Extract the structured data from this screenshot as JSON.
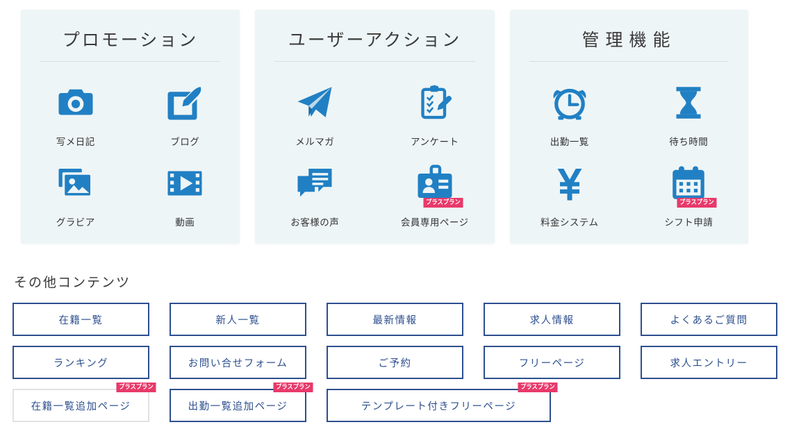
{
  "cards": [
    {
      "title": "プロモーション",
      "items": [
        {
          "label": "写メ日記",
          "icon": "camera-icon",
          "badge": null
        },
        {
          "label": "ブログ",
          "icon": "pencil-square-icon",
          "badge": null
        },
        {
          "label": "グラビア",
          "icon": "photos-icon",
          "badge": null
        },
        {
          "label": "動画",
          "icon": "film-play-icon",
          "badge": null
        }
      ]
    },
    {
      "title": "ユーザーアクション",
      "items": [
        {
          "label": "メルマガ",
          "icon": "paper-plane-icon",
          "badge": null
        },
        {
          "label": "アンケート",
          "icon": "clipboard-pencil-icon",
          "badge": null
        },
        {
          "label": "お客様の声",
          "icon": "chat-bubbles-icon",
          "badge": null
        },
        {
          "label": "会員専用ページ",
          "icon": "id-card-icon",
          "badge": "プラスプラン"
        }
      ]
    },
    {
      "title": "管理機能",
      "items": [
        {
          "label": "出勤一覧",
          "icon": "alarm-clock-icon",
          "badge": null
        },
        {
          "label": "待ち時間",
          "icon": "hourglass-icon",
          "badge": null
        },
        {
          "label": "料金システム",
          "icon": "yen-icon",
          "badge": null
        },
        {
          "label": "シフト申請",
          "icon": "calendar-icon",
          "badge": "プラスプラン"
        }
      ]
    }
  ],
  "other": {
    "heading": "その他コンテンツ",
    "buttons": [
      {
        "label": "在籍一覧",
        "badge": null,
        "disabled": false,
        "wide": false
      },
      {
        "label": "新人一覧",
        "badge": null,
        "disabled": false,
        "wide": false
      },
      {
        "label": "最新情報",
        "badge": null,
        "disabled": false,
        "wide": false
      },
      {
        "label": "求人情報",
        "badge": null,
        "disabled": false,
        "wide": false
      },
      {
        "label": "よくあるご質問",
        "badge": null,
        "disabled": false,
        "wide": false
      },
      {
        "label": "ランキング",
        "badge": null,
        "disabled": false,
        "wide": false
      },
      {
        "label": "お問い合せフォーム",
        "badge": null,
        "disabled": false,
        "wide": false
      },
      {
        "label": "ご予約",
        "badge": null,
        "disabled": false,
        "wide": false
      },
      {
        "label": "フリーページ",
        "badge": null,
        "disabled": false,
        "wide": false
      },
      {
        "label": "求人エントリー",
        "badge": null,
        "disabled": false,
        "wide": false
      },
      {
        "label": "在籍一覧追加ページ",
        "badge": "プラスプラン",
        "disabled": true,
        "wide": false
      },
      {
        "label": "出勤一覧追加ページ",
        "badge": "プラスプラン",
        "disabled": false,
        "wide": false
      },
      {
        "label": "テンプレート付きフリーページ",
        "badge": "プラスプラン",
        "disabled": false,
        "wide": true
      }
    ]
  },
  "colors": {
    "icon_blue": "#2180c4",
    "card_bg": "#eef5f6",
    "button_border": "#2d4f8e",
    "button_text": "#2d4f8e",
    "badge_bg": "#e8396a",
    "disabled_border": "#e2e2e2",
    "label_text": "#333333"
  }
}
